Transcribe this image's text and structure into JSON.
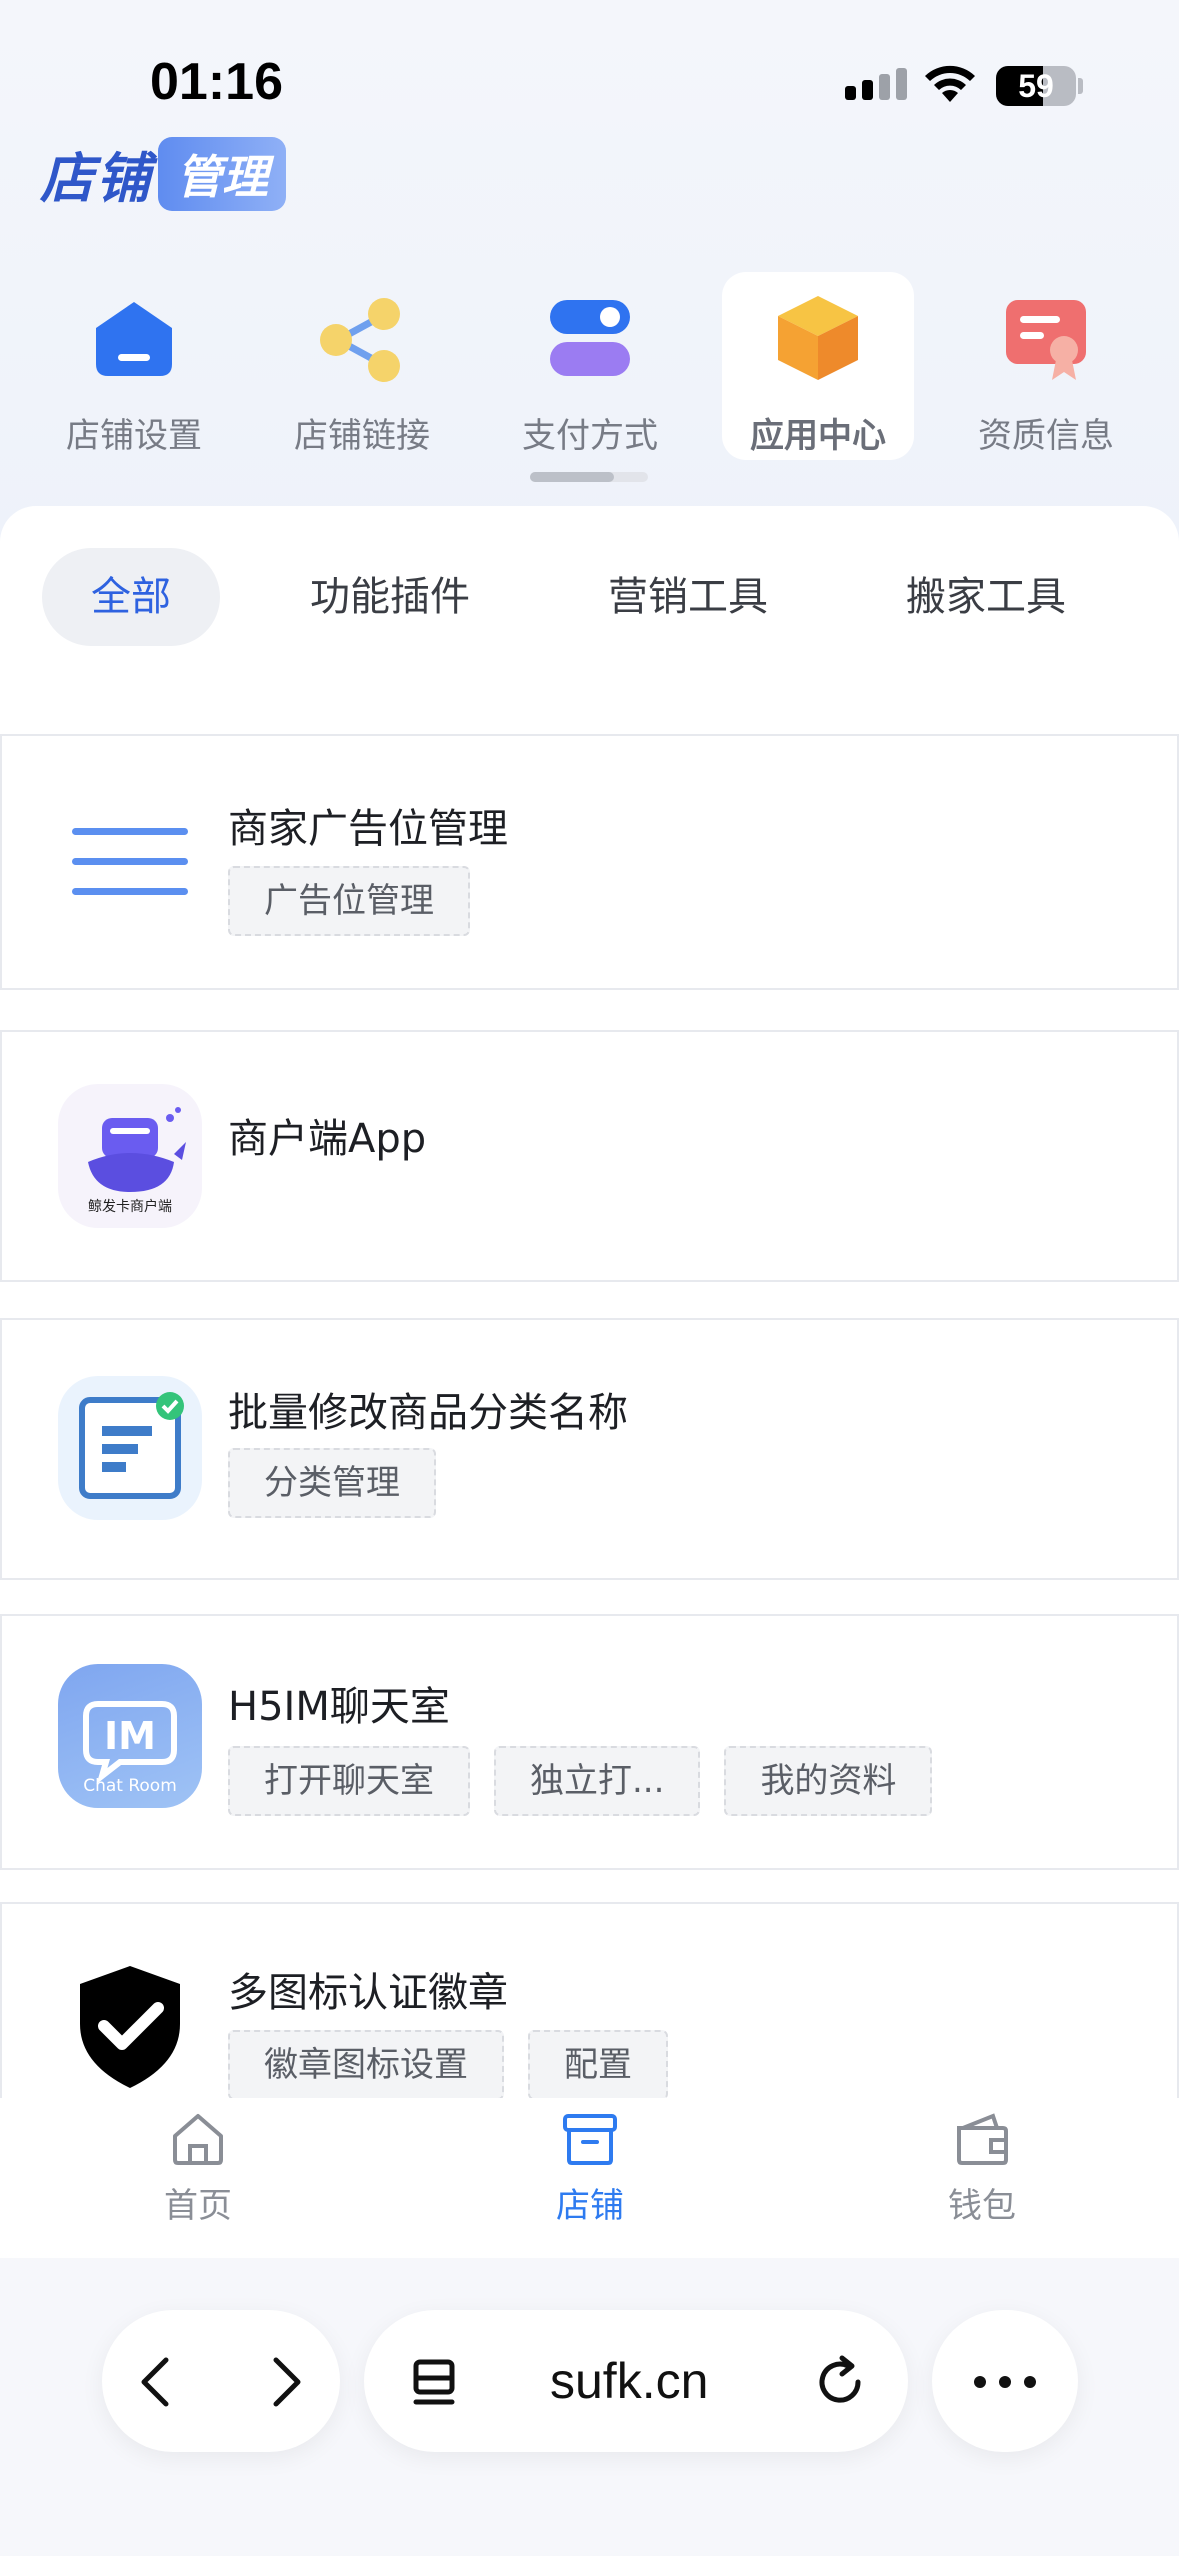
{
  "status_bar": {
    "time": "01:16",
    "battery": "59",
    "battery_level": 0.59
  },
  "brand": {
    "part1": "店铺",
    "part2": "管理"
  },
  "categories": [
    {
      "label": "店铺设置",
      "icon": "store-settings-icon",
      "active": false
    },
    {
      "label": "店铺链接",
      "icon": "share-link-icon",
      "active": false
    },
    {
      "label": "支付方式",
      "icon": "payment-toggle-icon",
      "active": false
    },
    {
      "label": "应用中心",
      "icon": "app-box-icon",
      "active": true
    },
    {
      "label": "资质信息",
      "icon": "certificate-icon",
      "active": false
    }
  ],
  "filter_tabs": [
    "全部",
    "功能插件",
    "营销工具",
    "搬家工具"
  ],
  "apps": [
    {
      "title": "商家广告位管理",
      "icon": "menu-lines-icon",
      "tags": [
        "广告位管理"
      ]
    },
    {
      "title": "商户端App",
      "icon": "whale-app-icon",
      "icon_caption": "鲸发卡商户端",
      "tags": []
    },
    {
      "title": "批量修改商品分类名称",
      "icon": "category-edit-icon",
      "tags": [
        "分类管理"
      ]
    },
    {
      "title": "H5IM聊天室",
      "icon": "chat-room-icon",
      "icon_caption": "Chat Room",
      "icon_text": "IM",
      "tags": [
        "打开聊天室",
        "独立打...",
        "我的资料"
      ]
    },
    {
      "title": "多图标认证徽章",
      "icon": "shield-check-icon",
      "tags": [
        "徽章图标设置",
        "配置"
      ]
    }
  ],
  "tabbar": [
    {
      "label": "首页",
      "icon": "home-icon",
      "active": false
    },
    {
      "label": "店铺",
      "icon": "store-box-icon",
      "active": true
    },
    {
      "label": "钱包",
      "icon": "wallet-icon",
      "active": false
    }
  ],
  "browser": {
    "url": "sufk.cn"
  },
  "colors": {
    "accent": "#2e62e0",
    "active_tab": "#2e7bf0",
    "brand": "#2f57c9"
  }
}
